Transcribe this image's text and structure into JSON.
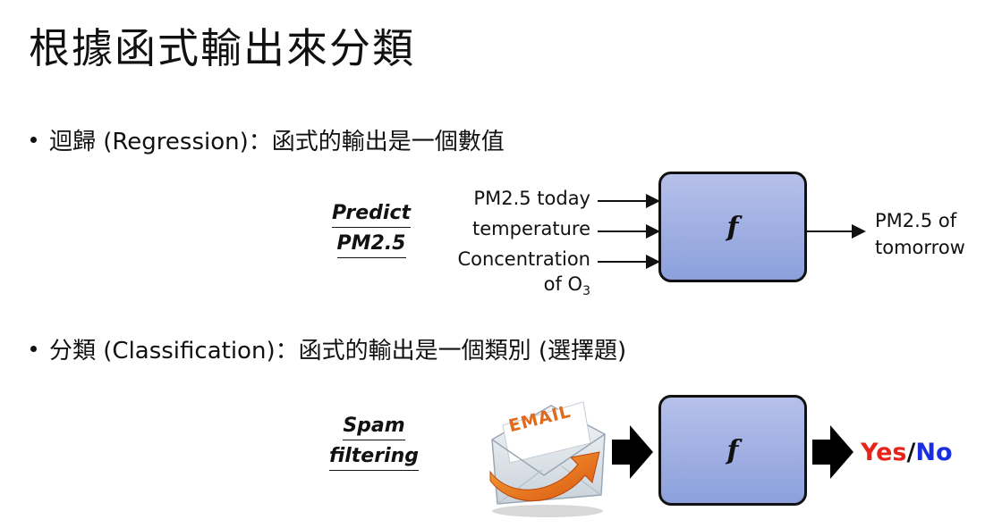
{
  "title": "根據函式輸出來分類",
  "regression": {
    "bullet": "迴歸 (Regression)：函式的輸出是一個數值",
    "task_line1": "Predict",
    "task_line2": "PM2.5",
    "inputs": [
      "PM2.5 today",
      "temperature",
      "Concentration"
    ],
    "input_last_line": "of O",
    "input_last_sub": "3",
    "function_label": "f",
    "output_line1": "PM2.5 of",
    "output_line2": "tomorrow"
  },
  "classification": {
    "bullet": "分類 (Classification)：函式的輸出是一個類別 (選擇題)",
    "task_line1": "Spam",
    "task_line2": "filtering",
    "email_label": "EMAIL",
    "function_label": "f",
    "yes": "Yes",
    "slash": "/",
    "no": "No",
    "colors": {
      "yes": "#e8231a",
      "no": "#1a2ee0"
    }
  }
}
